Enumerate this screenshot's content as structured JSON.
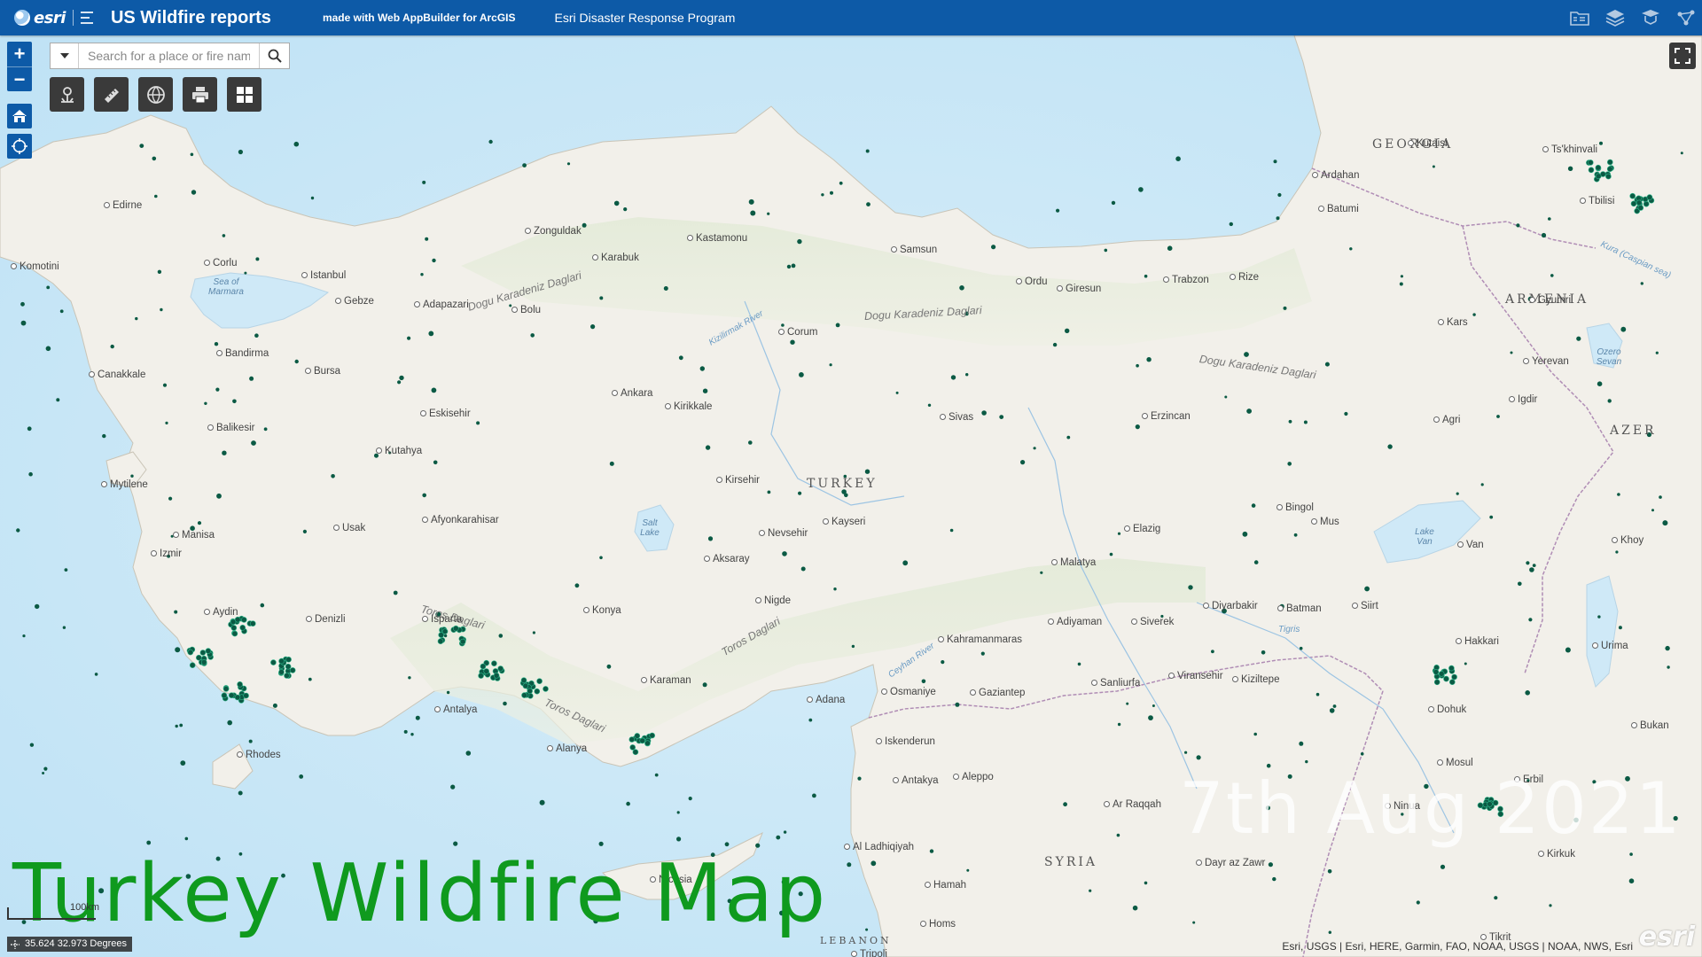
{
  "header": {
    "logo_text": "esri",
    "title": "US Wildfire reports",
    "subtitle": "made with Web AppBuilder for ArcGIS",
    "link": "Esri Disaster Response Program",
    "icons": [
      "folder-icon",
      "layers-icon",
      "legend-icon",
      "share-icon"
    ]
  },
  "search": {
    "placeholder": "Search for a place or fire name"
  },
  "widgets": {
    "zoom_in": "+",
    "zoom_out": "−",
    "toolbar": [
      "directions-icon",
      "measure-icon",
      "basemap-gallery-icon",
      "print-icon",
      "grid-icon"
    ]
  },
  "overlay": {
    "title": "Turkey Wildfire Map",
    "date": "7th Aug 2021"
  },
  "status": {
    "coordinates": "35.624 32.973 Degrees",
    "scale_label": "100km",
    "attribution": "Esri, USGS | Esri, HERE, Garmin, FAO, NOAA, USGS | NOAA, NWS, Esri",
    "watermark": "esri"
  },
  "map_labels": {
    "countries": [
      {
        "name": "TURKEY"
      },
      {
        "name": "GEORGIA"
      },
      {
        "name": "ARMENIA"
      },
      {
        "name": "SYRIA"
      },
      {
        "name": "AZER"
      },
      {
        "name": "LEBANON"
      }
    ],
    "cities": [
      "Istanbul",
      "Corlu",
      "Edirne",
      "Komotini",
      "Gebze",
      "Adapazari",
      "Bolu",
      "Zonguldak",
      "Karabuk",
      "Kastamonu",
      "Samsun",
      "Ordu",
      "Giresun",
      "Trabzon",
      "Rize",
      "Batumi",
      "Kutaisi",
      "Ts'khinvali",
      "Tbilisi",
      "Gyumri",
      "Kars",
      "Yerevan",
      "Igdir",
      "Agri",
      "Erzincan",
      "Sivas",
      "Corum",
      "Ankara",
      "Kirikkale",
      "Kirsehir",
      "Kayseri",
      "Nevsehir",
      "Aksaray",
      "Nigde",
      "Konya",
      "Karaman",
      "Eskisehir",
      "Bursa",
      "Bandirma",
      "Canakkale",
      "Balikesir",
      "Kutahya",
      "Afyonkarahisar",
      "Usak",
      "Manisa",
      "Izmir",
      "Mytilene",
      "Aydin",
      "Denizli",
      "Isparta",
      "Antalya",
      "Alanya",
      "Rhodes",
      "Adana",
      "Osmaniye",
      "Kahramanmaras",
      "Gaziantep",
      "Iskenderun",
      "Antakya",
      "Aleppo",
      "Al Ladhiqiyah",
      "Hamah",
      "Homs",
      "Tripoli",
      "Nicosia",
      "Adiyaman",
      "Malatya",
      "Elazig",
      "Bingol",
      "Mus",
      "Van",
      "Siverek",
      "Sanliurfa",
      "Viransehir",
      "Kiziltepe",
      "Diyarbakir",
      "Batman",
      "Siirt",
      "Hakkari",
      "Urima",
      "Dohuk",
      "Mosul",
      "Erbil",
      "Ar Raqqah",
      "Dayr az Zawr",
      "Khoy",
      "Bukan",
      "Kirkuk",
      "Tikrit",
      "Ninua",
      "Ardahan"
    ],
    "ranges": [
      "Dogu Karadeniz Daglari",
      "Toros Daglari"
    ],
    "waters": [
      "Sea of Marmara",
      "Salt Lake",
      "Lake Van",
      "Ozero Sevan"
    ],
    "rivers": [
      "Kizilirmak River",
      "Ceyhan River",
      "Tigris",
      "Kura (Caspian sea)"
    ]
  },
  "colors": {
    "header_bg": "#0d5aa7",
    "widget_bg": "#0d5aa7",
    "tool_bg": "#3a3a3a",
    "sea": "#cfe9f7",
    "land": "#f2f0ea",
    "fire_points": "#0b5a44",
    "overlay_title": "#0f9a1e"
  }
}
